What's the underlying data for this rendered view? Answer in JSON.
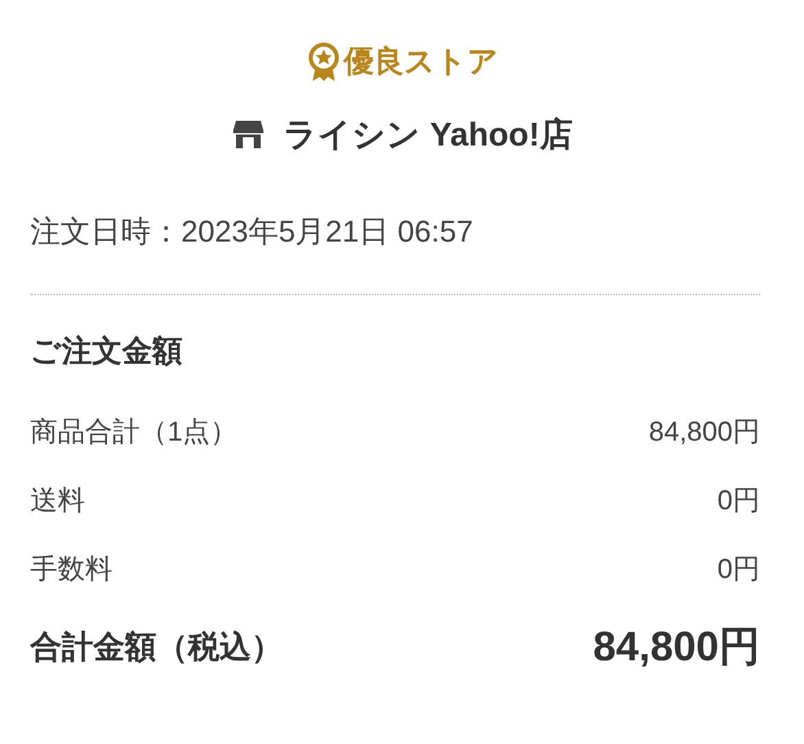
{
  "store": {
    "badge": "優良ストア",
    "name": "ライシン Yahoo!店"
  },
  "order_date": "注文日時：2023年5月21日 06:57",
  "summary": {
    "heading": "ご注文金額",
    "rows": [
      {
        "label": "商品合計（1点）",
        "value": "84,800円"
      },
      {
        "label": "送料",
        "value": "0円"
      },
      {
        "label": "手数料",
        "value": "0円"
      }
    ],
    "total": {
      "label": "合計金額（税込）",
      "value": "84,800円"
    }
  }
}
